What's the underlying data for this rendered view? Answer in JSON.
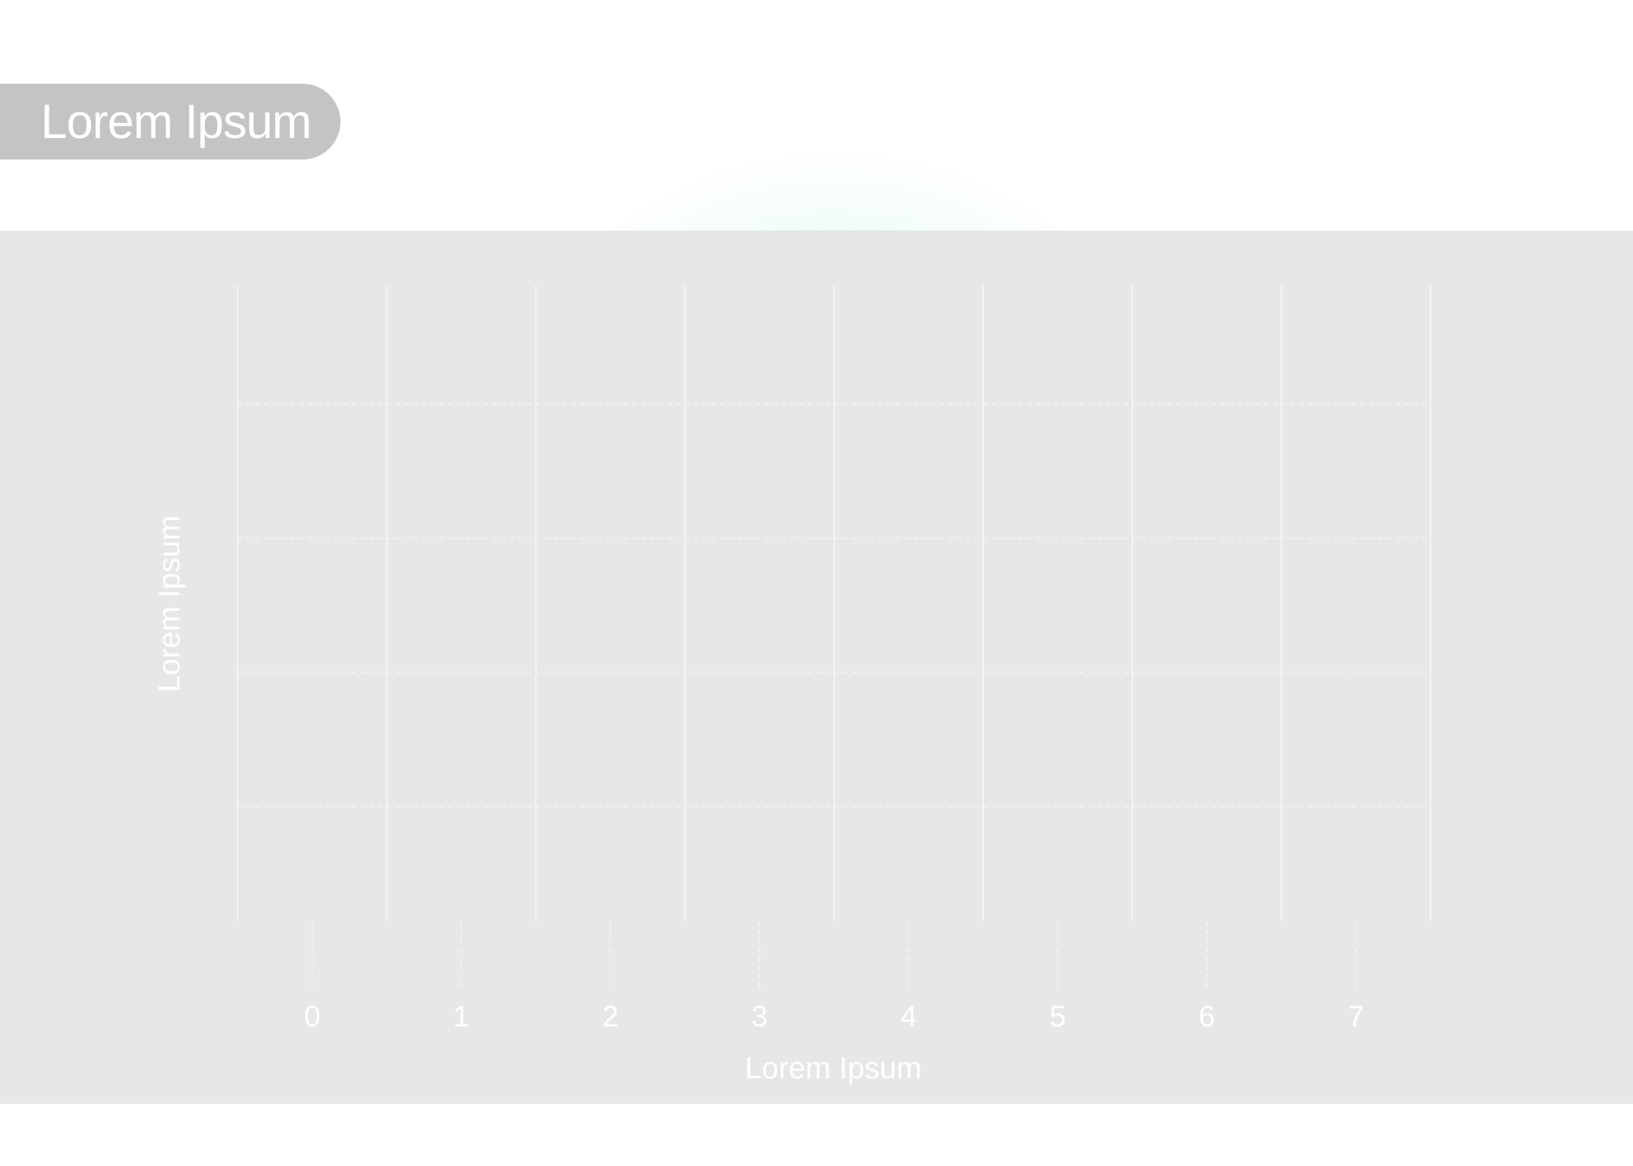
{
  "header": {
    "title": "Lorem Ipsum"
  },
  "colors": {
    "band_background": "#e6e7e7",
    "pill_background": "#c4c4c4",
    "glow": "#80e8b6",
    "text": "#ffffff"
  },
  "chart_data": {
    "type": "bar",
    "title": "Lorem Ipsum",
    "xlabel": "Lorem Ipsum",
    "ylabel": "Lorem Ipsum",
    "categories": [
      "0",
      "1",
      "2",
      "3",
      "4",
      "5",
      "6",
      "7"
    ],
    "series": [],
    "grid": true,
    "y_grid_lines": 4,
    "legend": "none"
  }
}
